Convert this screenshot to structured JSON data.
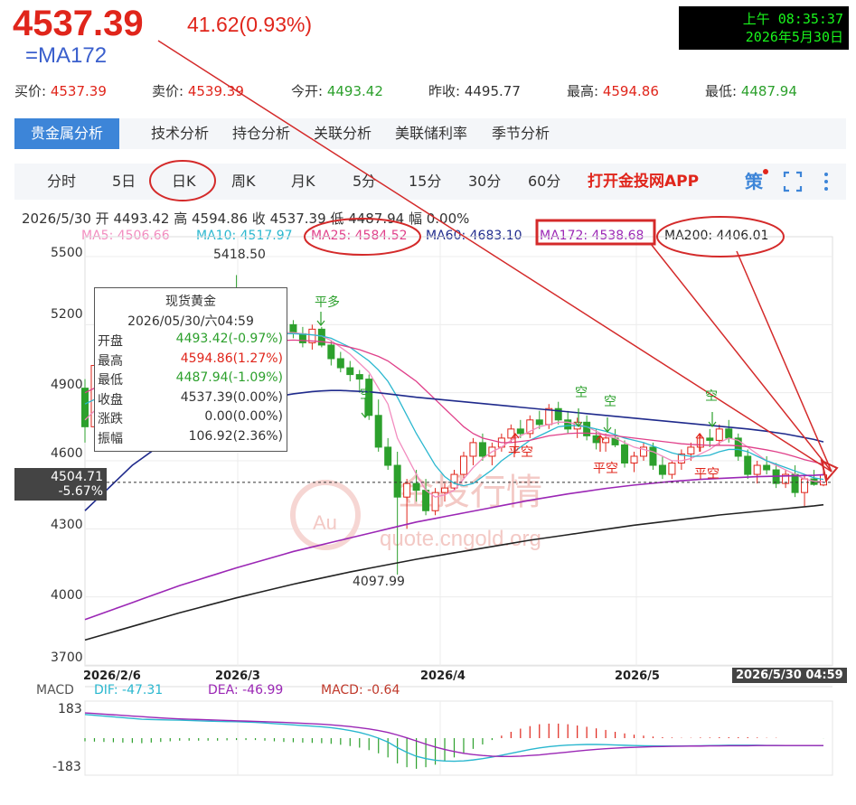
{
  "header": {
    "price": "4537.39",
    "change": "41.62(0.93%)",
    "subtitle": "=MA172",
    "clock_time": "上午 08:35:37",
    "clock_date": "2026年5月30日"
  },
  "quote": {
    "buy_label": "买价:",
    "buy": "4537.39",
    "sell_label": "卖价:",
    "sell": "4539.39",
    "open_label": "今开:",
    "open": "4493.42",
    "prev_label": "昨收:",
    "prev": "4495.77",
    "high_label": "最高:",
    "high": "4594.86",
    "low_label": "最低:",
    "low": "4487.94"
  },
  "tabs_main": [
    "贵金属分析",
    "技术分析",
    "持仓分析",
    "关联分析",
    "美联储利率",
    "季节分析"
  ],
  "tabs_period": [
    "分时",
    "5日",
    "日K",
    "周K",
    "月K",
    "5分",
    "15分",
    "30分",
    "60分"
  ],
  "app_button": "打开金投网APP",
  "strategy_label": "策",
  "bar_info": "2026/5/30 开 4493.42 高 4594.86 收 4537.39 低 4487.94 幅 0.00%",
  "ma_values": {
    "ma5": "MA5: 4506.66",
    "ma10": "MA10: 4517.97",
    "ma25": "MA25: 4584.52",
    "ma60": "MA60: 4683.10",
    "ma172": "MA172: 4538.68",
    "ma200": "MA200: 4406.01"
  },
  "crosshair": {
    "price": "4504.71",
    "pct": "-5.67%",
    "time": "2026/5/30 04:59"
  },
  "tooltip": {
    "title": "现货黄金",
    "date": "2026/05/30/六04:59",
    "rows": [
      {
        "label": "开盘",
        "value": "4493.42(-0.97%)",
        "color": "#2ca02c"
      },
      {
        "label": "最高",
        "value": "4594.86(1.27%)",
        "color": "#e0251b"
      },
      {
        "label": "最低",
        "value": "4487.94(-1.09%)",
        "color": "#2ca02c"
      },
      {
        "label": "收盘",
        "value": "4537.39(0.00%)",
        "color": "#333333"
      },
      {
        "label": "涨跌",
        "value": "0.00(0.00%)",
        "color": "#333333"
      },
      {
        "label": "振幅",
        "value": "106.92(2.36%)",
        "color": "#333333"
      }
    ]
  },
  "annotations": {
    "peak": "5418.50",
    "trough": "4097.99",
    "signals": [
      "平多",
      "空",
      "平空",
      "空",
      "空",
      "平空",
      "空",
      "平空"
    ]
  },
  "watermark": {
    "text": "金投行情",
    "url": "quote.cngold.org",
    "logo": "Au"
  },
  "macd": {
    "label": "MACD",
    "dif": "DIF: -47.31",
    "dea": "DEA: -46.99",
    "macd": "MACD: -0.64",
    "ytick_top": "183",
    "ytick_bottom": "-183"
  },
  "colors": {
    "up": "#e0251b",
    "down": "#2ca02c",
    "ma5": "#f28cbf",
    "ma10": "#2ab7cf",
    "ma25": "#e0408a",
    "ma60": "#1f2a8c",
    "ma172": "#9b27b5",
    "ma200": "#222222"
  },
  "chart_data": {
    "type": "candlestick",
    "title": "现货黄金",
    "x_ticks": [
      "2026/2/6",
      "2026/3",
      "2026/4",
      "2026/5",
      "2026/5/30 04:59"
    ],
    "y_ticks": [
      5500,
      5200,
      4900,
      4600,
      4300,
      4000,
      3700
    ],
    "ylim": [
      3700,
      5600
    ],
    "grid": true,
    "candles": [
      [
        4920,
        4960,
        4680,
        4750
      ],
      [
        4750,
        5050,
        4740,
        5020
      ],
      [
        5020,
        5100,
        4950,
        4980
      ],
      [
        4980,
        5120,
        4960,
        5090
      ],
      [
        5090,
        5180,
        5050,
        5140
      ],
      [
        5140,
        5200,
        5000,
        5060
      ],
      [
        5060,
        5130,
        5010,
        5110
      ],
      [
        5110,
        5180,
        5070,
        5090
      ],
      [
        5090,
        5150,
        4990,
        5020
      ],
      [
        5020,
        5120,
        5000,
        5100
      ],
      [
        5100,
        5180,
        5060,
        5150
      ],
      [
        5150,
        5200,
        5100,
        5120
      ],
      [
        5120,
        5160,
        5040,
        5060
      ],
      [
        5060,
        5140,
        5030,
        5120
      ],
      [
        5120,
        5190,
        5080,
        5160
      ],
      [
        5160,
        5300,
        5120,
        5280
      ],
      [
        5280,
        5418.5,
        5150,
        5180
      ],
      [
        5180,
        5250,
        5100,
        5230
      ],
      [
        5230,
        5260,
        5130,
        5160
      ],
      [
        5160,
        5200,
        5080,
        5130
      ],
      [
        5130,
        5180,
        5100,
        5170
      ],
      [
        5170,
        5230,
        5130,
        5200
      ],
      [
        5200,
        5220,
        5140,
        5160
      ],
      [
        5160,
        5190,
        5100,
        5120
      ],
      [
        5120,
        5200,
        5090,
        5180
      ],
      [
        5180,
        5190,
        5100,
        5110
      ],
      [
        5110,
        5130,
        5020,
        5050
      ],
      [
        5050,
        5080,
        4990,
        5010
      ],
      [
        5010,
        5040,
        4950,
        4980
      ],
      [
        4980,
        5000,
        4900,
        4960
      ],
      [
        4960,
        4980,
        4780,
        4800
      ],
      [
        4800,
        4870,
        4640,
        4660
      ],
      [
        4660,
        4700,
        4560,
        4580
      ],
      [
        4580,
        4640,
        4097.99,
        4440
      ],
      [
        4440,
        4520,
        4300,
        4500
      ],
      [
        4500,
        4560,
        4420,
        4470
      ],
      [
        4470,
        4520,
        4360,
        4380
      ],
      [
        4380,
        4480,
        4360,
        4460
      ],
      [
        4460,
        4500,
        4420,
        4480
      ],
      [
        4480,
        4560,
        4470,
        4540
      ],
      [
        4540,
        4640,
        4520,
        4620
      ],
      [
        4620,
        4700,
        4580,
        4680
      ],
      [
        4680,
        4720,
        4600,
        4620
      ],
      [
        4620,
        4680,
        4580,
        4660
      ],
      [
        4660,
        4720,
        4640,
        4700
      ],
      [
        4700,
        4760,
        4680,
        4740
      ],
      [
        4740,
        4780,
        4700,
        4720
      ],
      [
        4720,
        4800,
        4700,
        4780
      ],
      [
        4780,
        4820,
        4740,
        4760
      ],
      [
        4760,
        4850,
        4740,
        4830
      ],
      [
        4830,
        4860,
        4760,
        4780
      ],
      [
        4780,
        4820,
        4720,
        4740
      ],
      [
        4740,
        4790,
        4700,
        4770
      ],
      [
        4770,
        4800,
        4690,
        4710
      ],
      [
        4710,
        4740,
        4650,
        4680
      ],
      [
        4680,
        4720,
        4640,
        4700
      ],
      [
        4700,
        4740,
        4660,
        4670
      ],
      [
        4670,
        4690,
        4570,
        4590
      ],
      [
        4590,
        4640,
        4550,
        4620
      ],
      [
        4620,
        4680,
        4600,
        4660
      ],
      [
        4660,
        4680,
        4560,
        4580
      ],
      [
        4580,
        4620,
        4520,
        4540
      ],
      [
        4540,
        4600,
        4520,
        4590
      ],
      [
        4590,
        4650,
        4560,
        4630
      ],
      [
        4630,
        4680,
        4600,
        4660
      ],
      [
        4660,
        4720,
        4640,
        4700
      ],
      [
        4700,
        4740,
        4660,
        4690
      ],
      [
        4690,
        4760,
        4670,
        4740
      ],
      [
        4740,
        4780,
        4680,
        4700
      ],
      [
        4700,
        4720,
        4600,
        4620
      ],
      [
        4620,
        4650,
        4520,
        4540
      ],
      [
        4540,
        4600,
        4500,
        4580
      ],
      [
        4580,
        4620,
        4540,
        4560
      ],
      [
        4560,
        4590,
        4480,
        4500
      ],
      [
        4500,
        4560,
        4480,
        4540
      ],
      [
        4540,
        4580,
        4440,
        4460
      ],
      [
        4460,
        4540,
        4400,
        4520
      ],
      [
        4520,
        4560,
        4490,
        4495.77
      ],
      [
        4493.42,
        4594.86,
        4487.94,
        4537.39
      ]
    ],
    "series": [
      {
        "name": "MA5",
        "values": [
          4780,
          4820,
          4860,
          4900,
          4950,
          5000,
          5030,
          5060,
          5080,
          5090,
          5100,
          5105,
          5110,
          5115,
          5120,
          5140,
          5160,
          5175,
          5180,
          5175,
          5170,
          5165,
          5165,
          5160,
          5155,
          5150,
          5130,
          5100,
          5070,
          5030,
          4990,
          4920,
          4850,
          4700,
          4620,
          4540,
          4470,
          4440,
          4450,
          4470,
          4520,
          4570,
          4610,
          4640,
          4660,
          4690,
          4710,
          4730,
          4750,
          4760,
          4770,
          4770,
          4760,
          4750,
          4730,
          4710,
          4700,
          4680,
          4660,
          4650,
          4640,
          4620,
          4600,
          4600,
          4610,
          4630,
          4650,
          4680,
          4700,
          4690,
          4660,
          4630,
          4600,
          4580,
          4560,
          4540,
          4520,
          4510,
          4506.66
        ]
      },
      {
        "name": "MA10",
        "values": [
          4850,
          4870,
          4890,
          4920,
          4950,
          4980,
          5000,
          5020,
          5040,
          5060,
          5080,
          5090,
          5100,
          5105,
          5110,
          5120,
          5130,
          5140,
          5150,
          5155,
          5160,
          5160,
          5160,
          5158,
          5155,
          5150,
          5140,
          5120,
          5100,
          5070,
          5040,
          5000,
          4950,
          4880,
          4800,
          4720,
          4650,
          4580,
          4530,
          4500,
          4490,
          4500,
          4530,
          4560,
          4600,
          4630,
          4660,
          4690,
          4710,
          4730,
          4750,
          4755,
          4755,
          4750,
          4740,
          4730,
          4715,
          4700,
          4690,
          4680,
          4665,
          4650,
          4635,
          4625,
          4620,
          4620,
          4625,
          4640,
          4650,
          4650,
          4640,
          4620,
          4600,
          4585,
          4570,
          4555,
          4540,
          4525,
          4517.97
        ]
      },
      {
        "name": "MA25",
        "values": [
          4900,
          4920,
          4940,
          4960,
          4980,
          5000,
          5015,
          5030,
          5045,
          5060,
          5070,
          5080,
          5090,
          5095,
          5100,
          5105,
          5110,
          5115,
          5120,
          5125,
          5128,
          5130,
          5132,
          5130,
          5128,
          5125,
          5120,
          5110,
          5100,
          5090,
          5075,
          5060,
          5040,
          5010,
          4980,
          4950,
          4910,
          4870,
          4830,
          4790,
          4750,
          4720,
          4700,
          4690,
          4680,
          4680,
          4685,
          4690,
          4700,
          4710,
          4715,
          4720,
          4722,
          4722,
          4720,
          4715,
          4710,
          4705,
          4700,
          4695,
          4690,
          4685,
          4680,
          4675,
          4672,
          4670,
          4668,
          4668,
          4668,
          4666,
          4662,
          4655,
          4648,
          4640,
          4630,
          4618,
          4605,
          4595,
          4584.52
        ]
      },
      {
        "name": "MA60",
        "values": [
          4380,
          4420,
          4460,
          4500,
          4540,
          4580,
          4610,
          4640,
          4670,
          4700,
          4720,
          4740,
          4760,
          4780,
          4800,
          4815,
          4830,
          4845,
          4860,
          4870,
          4880,
          4888,
          4895,
          4900,
          4905,
          4908,
          4910,
          4910,
          4908,
          4906,
          4904,
          4900,
          4895,
          4890,
          4885,
          4880,
          4876,
          4872,
          4868,
          4864,
          4860,
          4856,
          4852,
          4848,
          4844,
          4840,
          4836,
          4832,
          4828,
          4824,
          4820,
          4816,
          4812,
          4808,
          4804,
          4800,
          4796,
          4792,
          4788,
          4784,
          4780,
          4776,
          4772,
          4768,
          4764,
          4760,
          4756,
          4752,
          4748,
          4744,
          4740,
          4735,
          4730,
          4724,
          4718,
          4710,
          4702,
          4694,
          4683.1
        ]
      },
      {
        "name": "MA172",
        "values": [
          3900,
          3915,
          3930,
          3945,
          3960,
          3975,
          3990,
          4005,
          4020,
          4035,
          4050,
          4063,
          4076,
          4089,
          4102,
          4115,
          4128,
          4140,
          4152,
          4164,
          4176,
          4188,
          4200,
          4210,
          4220,
          4230,
          4240,
          4250,
          4260,
          4270,
          4280,
          4290,
          4300,
          4310,
          4320,
          4330,
          4338,
          4346,
          4354,
          4362,
          4370,
          4378,
          4386,
          4394,
          4402,
          4410,
          4418,
          4426,
          4433,
          4440,
          4447,
          4454,
          4460,
          4466,
          4472,
          4478,
          4483,
          4488,
          4493,
          4497,
          4501,
          4505,
          4509,
          4512,
          4515,
          4518,
          4520,
          4522,
          4524,
          4526,
          4528,
          4530,
          4531,
          4532,
          4533,
          4534,
          4535,
          4536,
          4538.68
        ]
      },
      {
        "name": "MA200",
        "values": [
          3810,
          3822,
          3834,
          3846,
          3858,
          3870,
          3882,
          3894,
          3906,
          3918,
          3930,
          3941,
          3952,
          3963,
          3974,
          3985,
          3996,
          4006,
          4016,
          4026,
          4036,
          4046,
          4056,
          4065,
          4074,
          4083,
          4092,
          4101,
          4110,
          4118,
          4126,
          4134,
          4142,
          4150,
          4158,
          4166,
          4173,
          4180,
          4187,
          4194,
          4201,
          4208,
          4215,
          4222,
          4229,
          4236,
          4243,
          4250,
          4256,
          4262,
          4268,
          4274,
          4280,
          4286,
          4292,
          4298,
          4304,
          4310,
          4316,
          4321,
          4326,
          4331,
          4336,
          4341,
          4346,
          4351,
          4356,
          4361,
          4365,
          4369,
          4373,
          4377,
          4381,
          4385,
          4389,
          4393,
          4397,
          4401,
          4406.01
        ]
      }
    ],
    "macd_series": {
      "dif": [
        150,
        145,
        140,
        135,
        130,
        125,
        120,
        118,
        116,
        115,
        114,
        112,
        110,
        108,
        106,
        105,
        104,
        102,
        100,
        96,
        92,
        88,
        84,
        80,
        76,
        72,
        66,
        58,
        48,
        36,
        20,
        0,
        -25,
        -60,
        -90,
        -115,
        -130,
        -140,
        -145,
        -146,
        -144,
        -138,
        -130,
        -120,
        -108,
        -96,
        -84,
        -72,
        -62,
        -54,
        -48,
        -44,
        -42,
        -40,
        -40,
        -41,
        -43,
        -45,
        -47,
        -48,
        -49,
        -50,
        -50,
        -50,
        -49,
        -48,
        -47,
        -46,
        -45,
        -45,
        -45,
        -45,
        -46,
        -46,
        -47,
        -47,
        -47,
        -47,
        -47.31
      ],
      "dea": [
        160,
        156,
        152,
        148,
        144,
        140,
        136,
        132,
        128,
        125,
        122,
        120,
        118,
        116,
        114,
        112,
        110,
        108,
        106,
        104,
        102,
        100,
        97,
        94,
        91,
        88,
        84,
        79,
        73,
        66,
        58,
        48,
        36,
        20,
        2,
        -18,
        -38,
        -56,
        -72,
        -85,
        -96,
        -104,
        -110,
        -114,
        -116,
        -116,
        -114,
        -110,
        -106,
        -100,
        -94,
        -88,
        -82,
        -76,
        -71,
        -67,
        -63,
        -60,
        -58,
        -56,
        -54,
        -53,
        -52,
        -51,
        -50,
        -50,
        -49,
        -49,
        -48,
        -48,
        -48,
        -47,
        -47,
        -47,
        -47,
        -47,
        -47,
        -47,
        -46.99
      ]
    }
  }
}
